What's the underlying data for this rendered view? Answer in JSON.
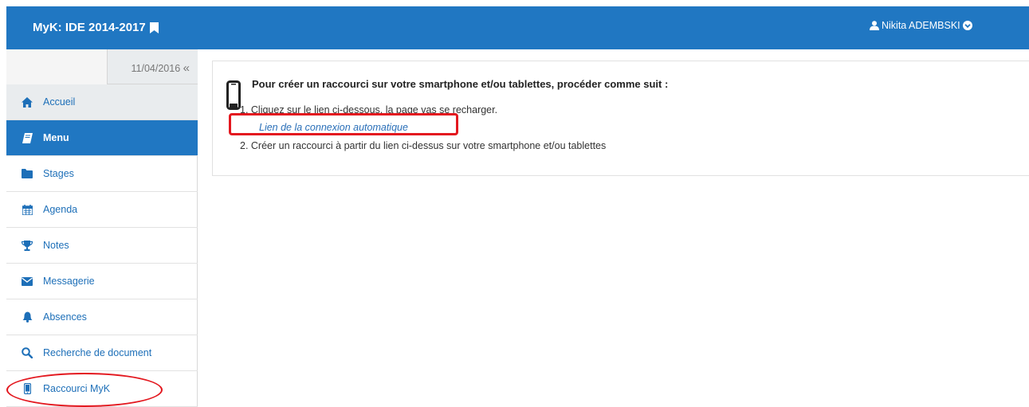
{
  "header": {
    "app_title": "MyK: IDE 2014-2017",
    "user_name": "Nikita ADEMBSKI"
  },
  "sidebar": {
    "date": "11/04/2016",
    "collapse_glyph": "«",
    "items": [
      {
        "label": "Accueil",
        "icon": "home-icon"
      },
      {
        "label": "Menu",
        "icon": "book-icon"
      },
      {
        "label": "Stages",
        "icon": "folder-icon"
      },
      {
        "label": "Agenda",
        "icon": "calendar-icon"
      },
      {
        "label": "Notes",
        "icon": "trophy-icon"
      },
      {
        "label": "Messagerie",
        "icon": "envelope-icon"
      },
      {
        "label": "Absences",
        "icon": "bell-icon"
      },
      {
        "label": "Recherche de document",
        "icon": "search-icon"
      },
      {
        "label": "Raccourci MyK",
        "icon": "mobile-icon"
      }
    ]
  },
  "main": {
    "title": "Pour créer un raccourci sur votre smartphone et/ou tablettes, procéder comme suit :",
    "step1": "1. Cliquez sur le lien ci-dessous, la page vas se recharger.",
    "link": "Lien de la connexion automatique",
    "step2": "2. Créer un raccourci à partir du lien ci-dessus sur votre smartphone et/ou tablettes"
  },
  "colors": {
    "brand": "#2077c2",
    "link": "#1d6fb8",
    "highlight": "#e3181f"
  }
}
